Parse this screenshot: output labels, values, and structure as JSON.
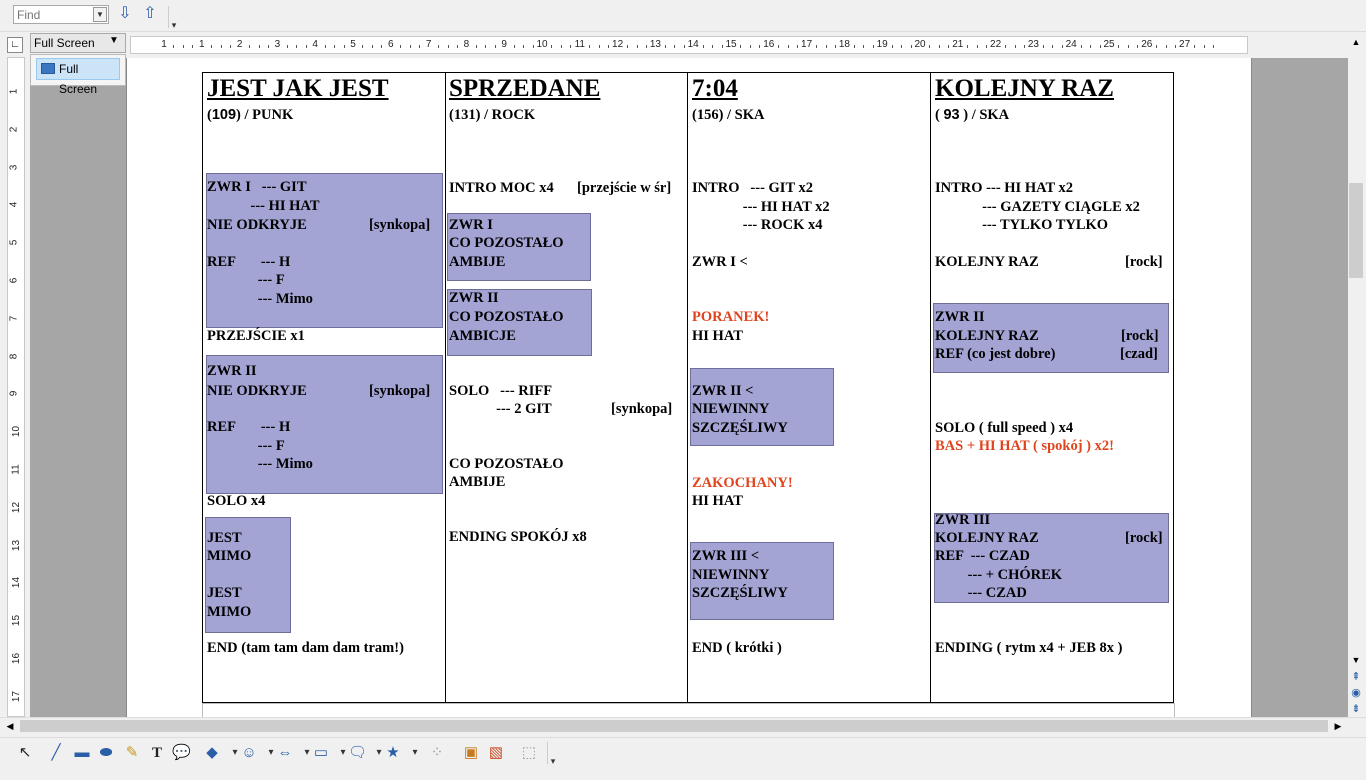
{
  "find_toolbar": {
    "search_placeholder": "Find",
    "find_next_icon": "arrow-down-icon",
    "find_prev_icon": "arrow-up-icon"
  },
  "zoom": {
    "selected": "Full Screen",
    "popup_item": "Full Screen"
  },
  "ruler": {
    "horizontal_numbers": [
      "1",
      "1",
      "2",
      "3",
      "4",
      "5",
      "6",
      "7",
      "8",
      "9",
      "10",
      "11",
      "12",
      "13",
      "14",
      "15",
      "16",
      "17",
      "18",
      "19",
      "20",
      "21",
      "22",
      "23",
      "24",
      "25",
      "26",
      "27"
    ],
    "vertical_numbers": [
      "1",
      "2",
      "3",
      "4",
      "5",
      "6",
      "7",
      "8",
      "9",
      "10",
      "11",
      "12",
      "13",
      "14",
      "15",
      "16",
      "17"
    ]
  },
  "document": {
    "columns": [
      {
        "title": "JEST JAK JEST",
        "tempo_num": "109",
        "tempo_pre": "(",
        "tempo_post": ") / PUNK",
        "blocks": {
          "zwr1_l1": "ZWR I   --- GIT",
          "zwr1_l2": "            --- HI HAT",
          "zwr1_l3": "NIE ODKRYJE",
          "zwr1_l3r": "[synkopa]",
          "ref1_l1": "REF       --- H",
          "ref1_l2": "              --- F",
          "ref1_l3": "              --- Mimo",
          "przejscie": "PRZEJŚCIE x1",
          "zwr2_l1": "ZWR II",
          "zwr2_l2": "NIE ODKRYJE",
          "zwr2_l2r": "[synkopa]",
          "ref2_l1": "REF       --- H",
          "ref2_l2": "              --- F",
          "ref2_l3": "              --- Mimo",
          "solo": "SOLO x4",
          "jest1": "JEST",
          "mimo1": "MIMO",
          "jest2": "JEST",
          "mimo2": "MIMO",
          "end": "END (tam tam dam dam tram!)"
        }
      },
      {
        "title": "SPRZEDANE",
        "tempo": "(131) / ROCK",
        "blocks": {
          "intro": "INTRO MOC x4",
          "intro_r": "[przejście w śr]",
          "zwr1_l1": "ZWR I",
          "zwr1_l2": "CO POZOSTAŁO",
          "zwr1_l3": "AMBIJE",
          "zwr2_l1": "ZWR II",
          "zwr2_l2": "CO POZOSTAŁO",
          "zwr2_l3": "AMBICJE",
          "solo_l1": "SOLO   --- RIFF",
          "solo_l2": "             --- 2 GIT",
          "solo_r": "[synkopa]",
          "co_l1": "CO POZOSTAŁO",
          "co_l2": "AMBIJE",
          "ending": "ENDING SPOKÓJ x8"
        }
      },
      {
        "title": "7:04",
        "tempo": "(156) / SKA",
        "blocks": {
          "intro_l1": "INTRO   --- GIT x2",
          "intro_l2": "              --- HI HAT x2",
          "intro_l3": "              --- ROCK x4",
          "zwr1": "ZWR I <",
          "poranek": "PORANEK!",
          "hihat1": "HI HAT",
          "zwr2_l1": "ZWR II <",
          "zwr2_l2": "NIEWINNY",
          "zwr2_l3": "SZCZĘŚLIWY",
          "zakochany": "ZAKOCHANY!",
          "hihat2": "HI HAT",
          "zwr3_l1": "ZWR III <",
          "zwr3_l2": "NIEWINNY",
          "zwr3_l3": "SZCZĘŚLIWY",
          "end": "END ( krótki )"
        }
      },
      {
        "title": "KOLEJNY RAZ",
        "tempo_pre": "( ",
        "tempo_num": "93",
        "tempo_post": " ) / SKA",
        "blocks": {
          "intro_l1": "INTRO --- HI HAT x2",
          "intro_l2": "             --- GAZETY CIĄGLE x2",
          "intro_l3": "             --- TYLKO TYLKO",
          "kolejny": "KOLEJNY RAZ",
          "kolejny_r": "[rock]",
          "zwr2_l1": "ZWR II",
          "zwr2_l2": "KOLEJNY RAZ",
          "zwr2_l2r": "[rock]",
          "zwr2_l3": "REF (co jest dobre)",
          "zwr2_l3r": "[czad]",
          "solo": "SOLO ( full speed ) x4",
          "bas": "BAS + HI HAT ( spokój ) x2!",
          "zwr3_l1": "ZWR III",
          "zwr3_l2": "KOLEJNY RAZ",
          "zwr3_l2r": "[rock]",
          "zwr3_l3": "REF  --- CZAD",
          "zwr3_l4": "         --- + CHÓREK",
          "zwr3_l5": "         --- CZAD",
          "ending": "ENDING ( rytm x4 + JEB 8x )"
        }
      }
    ]
  },
  "colors": {
    "highlight_box": "#a3a3d4",
    "red_text": "#e0441c",
    "workspace": "#a6a6a6"
  }
}
